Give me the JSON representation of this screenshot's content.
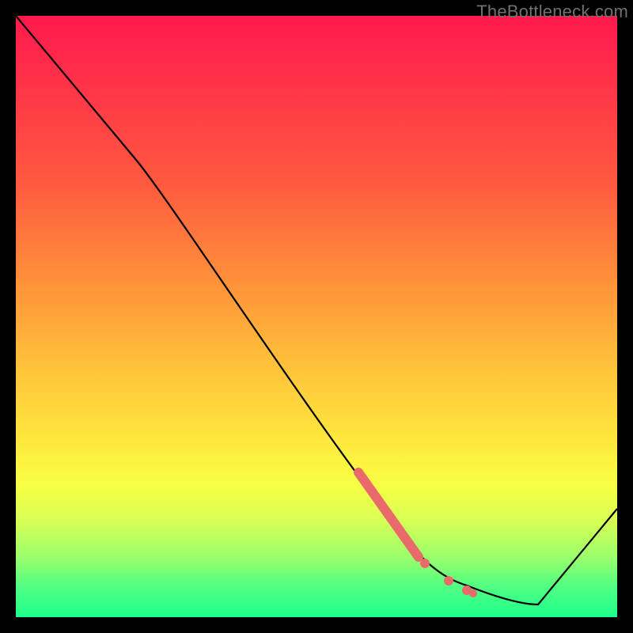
{
  "watermark": "TheBottleneck.com",
  "colors": {
    "frame": "#000000",
    "line": "#000000",
    "highlight": "#e86a6a",
    "gradient_top": "#ff1a4d",
    "gradient_upper_mid": "#ff943a",
    "gradient_mid": "#ffe63d",
    "gradient_lower_mid": "#9bff6b",
    "gradient_bottom": "#1eff8a"
  },
  "chart_data": {
    "type": "line",
    "title": "",
    "xlabel": "",
    "ylabel": "",
    "xlim": [
      0,
      100
    ],
    "ylim": [
      0,
      100
    ],
    "series": [
      {
        "name": "curve",
        "x": [
          0,
          20,
          65,
          72,
          80,
          85,
          100
        ],
        "y": [
          100,
          76,
          13,
          6,
          2,
          2,
          18
        ]
      }
    ],
    "highlight_segment": {
      "series": "curve",
      "x_range": [
        57,
        67
      ],
      "y_range": [
        24,
        10
      ]
    },
    "highlight_points": [
      {
        "x": 68,
        "y": 9
      },
      {
        "x": 72,
        "y": 6
      },
      {
        "x": 75,
        "y": 4.5
      },
      {
        "x": 76,
        "y": 4
      }
    ]
  }
}
